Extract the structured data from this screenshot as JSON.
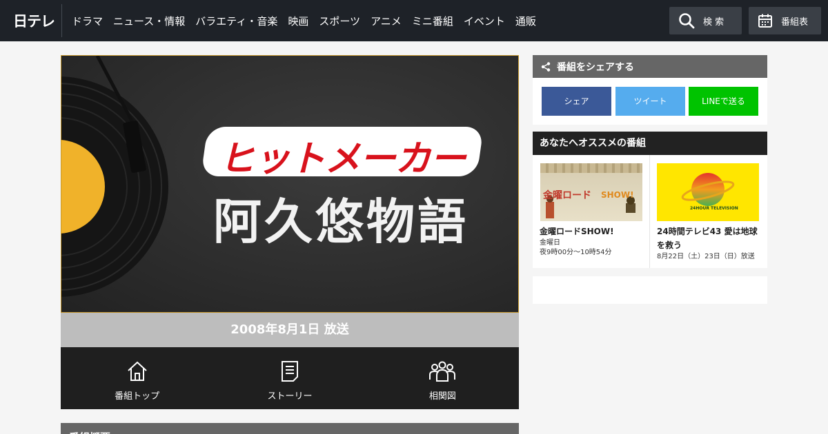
{
  "header": {
    "logo_text": "日テレ",
    "nav": [
      "ドラマ",
      "ニュース・情報",
      "バラエティ・音楽",
      "映画",
      "スポーツ",
      "アニメ",
      "ミニ番組",
      "イベント",
      "通販"
    ],
    "search_label": "検 索",
    "schedule_label": "番組表"
  },
  "hero": {
    "title": "ヒットメーカー",
    "subtitle": "阿久悠物語"
  },
  "airdate": "2008年8月1日 放送",
  "tabs": [
    {
      "label": "番組トップ",
      "icon": "home-icon"
    },
    {
      "label": "ストーリー",
      "icon": "document-icon"
    },
    {
      "label": "相関図",
      "icon": "people-icon"
    }
  ],
  "overview_heading": "番組概要",
  "share": {
    "heading": "番組をシェアする",
    "facebook": "シェア",
    "twitter": "ツイート",
    "line": "LINEで送る"
  },
  "recommend": {
    "heading": "あなたへオススメの番組",
    "items": [
      {
        "title": "金曜ロードSHOW!",
        "meta1": "金曜日",
        "meta2": "夜9時00分～10時54分",
        "thumb_kanji": "金曜ロード",
        "thumb_show": "SHOW!"
      },
      {
        "title": "24時間テレビ43 愛は地球を救う",
        "meta1": "8月22日（土）23日（日）放送",
        "thumb_text": "24HOUR TELEVISION"
      }
    ]
  },
  "colors": {
    "header_bg": "#1e2228",
    "title_red": "#d8121c",
    "facebook": "#3b5998",
    "twitter": "#55acee",
    "line": "#00c300",
    "record_label": "#f0b22a"
  }
}
